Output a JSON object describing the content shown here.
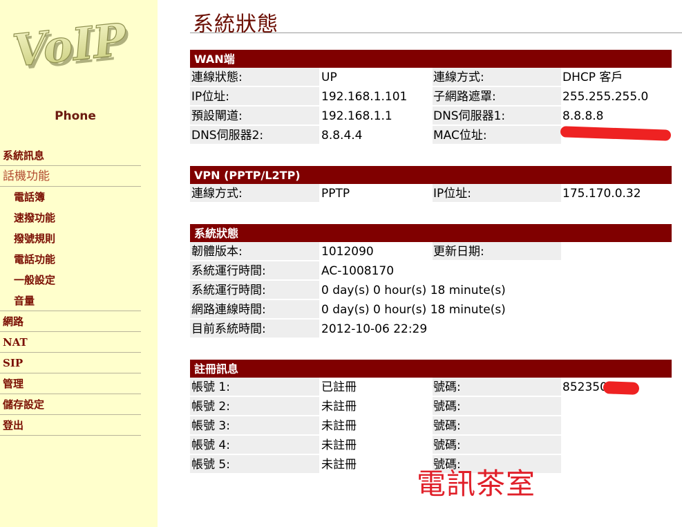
{
  "sidebar": {
    "logo_text": "VoIP",
    "device": "Phone",
    "items": [
      {
        "label": "系統訊息",
        "kind": "top"
      },
      {
        "label": "話機功能",
        "kind": "top-active"
      },
      {
        "label": "電話簿",
        "kind": "sub"
      },
      {
        "label": "速撥功能",
        "kind": "sub"
      },
      {
        "label": "撥號規則",
        "kind": "sub"
      },
      {
        "label": "電話功能",
        "kind": "sub"
      },
      {
        "label": "一般設定",
        "kind": "sub"
      },
      {
        "label": "音量",
        "kind": "sub-last"
      },
      {
        "label": "網路",
        "kind": "top"
      },
      {
        "label": "NAT",
        "kind": "top"
      },
      {
        "label": "SIP",
        "kind": "top"
      },
      {
        "label": "管理",
        "kind": "top"
      },
      {
        "label": "儲存設定",
        "kind": "top"
      },
      {
        "label": "登出",
        "kind": "top"
      }
    ]
  },
  "page_title": "系統狀態",
  "wan": {
    "header": "WAN端",
    "rows": [
      [
        "連線狀態:",
        "UP",
        "連線方式:",
        "DHCP 客戶"
      ],
      [
        "IP位址:",
        "192.168.1.101",
        "子網路遮罩:",
        "255.255.255.0"
      ],
      [
        "預設閘道:",
        "192.168.1.1",
        "DNS伺服器1:",
        "8.8.8.8"
      ],
      [
        "DNS伺服器2:",
        "8.8.4.4",
        "MAC位址:",
        ""
      ]
    ]
  },
  "vpn": {
    "header": "VPN (PPTP/L2TP)",
    "rows": [
      [
        "連線方式:",
        "PPTP",
        "IP位址:",
        "175.170.0.32"
      ]
    ]
  },
  "system": {
    "header": "系統狀態",
    "row0": [
      "韌體版本:",
      "1012090",
      "更新日期:",
      ""
    ],
    "rows": [
      [
        "系統運行時間:",
        "AC-1008170"
      ],
      [
        "系統運行時間:",
        "0 day(s) 0 hour(s) 18 minute(s)"
      ],
      [
        "網路連線時間:",
        "0 day(s) 0 hour(s) 18 minute(s)"
      ],
      [
        "目前系統時間:",
        "2012-10-06 22:29"
      ]
    ]
  },
  "registration": {
    "header": "註冊訊息",
    "rows": [
      [
        "帳號 1:",
        "已註冊",
        "號碼:",
        "852350"
      ],
      [
        "帳號 2:",
        "未註冊",
        "號碼:",
        ""
      ],
      [
        "帳號 3:",
        "未註冊",
        "號碼:",
        ""
      ],
      [
        "帳號 4:",
        "未註冊",
        "號碼:",
        ""
      ],
      [
        "帳號 5:",
        "未註冊",
        "號碼:",
        ""
      ]
    ]
  },
  "watermark": "電訊茶室",
  "colors": {
    "sidebar_bg": "#ffffcc",
    "header_bg": "#800000",
    "nav_text": "#7a0e02",
    "label_bg": "#eeeeee",
    "redaction": "#ee2222"
  }
}
